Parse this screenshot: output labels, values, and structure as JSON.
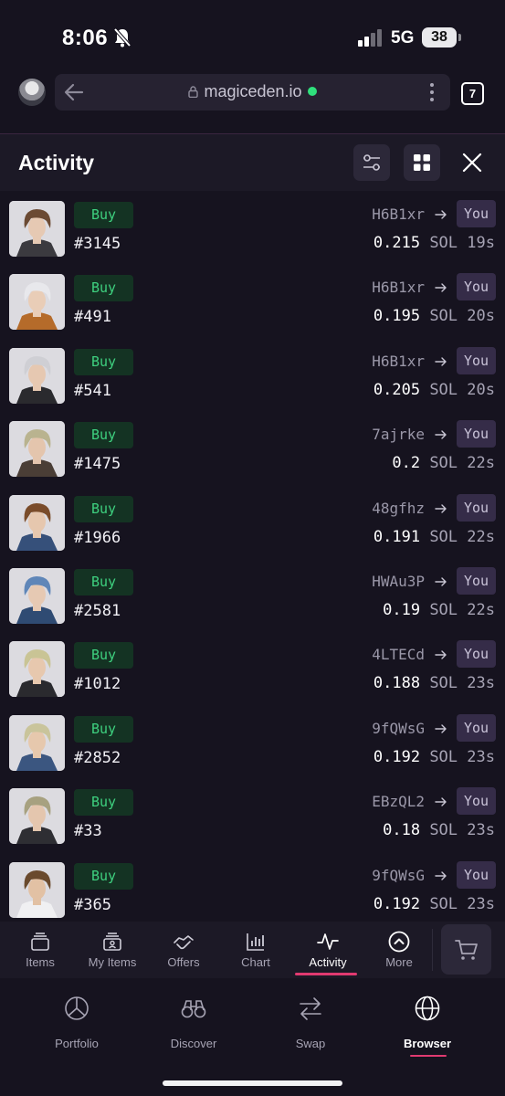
{
  "status_bar": {
    "time": "8:06",
    "network": "5G",
    "battery": "38"
  },
  "browser": {
    "url": "magiceden.io",
    "tab_count": "7"
  },
  "header": {
    "title": "Activity"
  },
  "activity": [
    {
      "type": "Buy",
      "item": "#3145",
      "from": "H6B1xr",
      "to": "You",
      "price": "0.215",
      "currency": "SOL",
      "time": "19s",
      "hair": "#6b4a33",
      "skin": "#e6c9b3",
      "shirt": "#3b3a3f"
    },
    {
      "type": "Buy",
      "item": "#491",
      "from": "H6B1xr",
      "to": "You",
      "price": "0.195",
      "currency": "SOL",
      "time": "20s",
      "hair": "#e8e8ec",
      "skin": "#e9cdb7",
      "shirt": "#b56b2a"
    },
    {
      "type": "Buy",
      "item": "#541",
      "from": "H6B1xr",
      "to": "You",
      "price": "0.205",
      "currency": "SOL",
      "time": "20s",
      "hair": "#cfcfd4",
      "skin": "#e6c8b1",
      "shirt": "#2a2a2e"
    },
    {
      "type": "Buy",
      "item": "#1475",
      "from": "7ajrke",
      "to": "You",
      "price": "0.2",
      "currency": "SOL",
      "time": "22s",
      "hair": "#b9b38f",
      "skin": "#e4c5ad",
      "shirt": "#4a3e36"
    },
    {
      "type": "Buy",
      "item": "#1966",
      "from": "48gfhz",
      "to": "You",
      "price": "0.191",
      "currency": "SOL",
      "time": "22s",
      "hair": "#7a4c2a",
      "skin": "#e6c7ae",
      "shirt": "#36507a"
    },
    {
      "type": "Buy",
      "item": "#2581",
      "from": "HWAu3P",
      "to": "You",
      "price": "0.19",
      "currency": "SOL",
      "time": "22s",
      "hair": "#5f86b8",
      "skin": "#e6c9b3",
      "shirt": "#2f4b73"
    },
    {
      "type": "Buy",
      "item": "#1012",
      "from": "4LTECd",
      "to": "You",
      "price": "0.188",
      "currency": "SOL",
      "time": "23s",
      "hair": "#c9c495",
      "skin": "#e7c8ae",
      "shirt": "#2a2a2e"
    },
    {
      "type": "Buy",
      "item": "#2852",
      "from": "9fQWsG",
      "to": "You",
      "price": "0.192",
      "currency": "SOL",
      "time": "23s",
      "hair": "#c9c49b",
      "skin": "#e6c8ad",
      "shirt": "#3b5680"
    },
    {
      "type": "Buy",
      "item": "#33",
      "from": "EBzQL2",
      "to": "You",
      "price": "0.18",
      "currency": "SOL",
      "time": "23s",
      "hair": "#a7a180",
      "skin": "#e4c6ae",
      "shirt": "#2e2e33"
    },
    {
      "type": "Buy",
      "item": "#365",
      "from": "9fQWsG",
      "to": "You",
      "price": "0.192",
      "currency": "SOL",
      "time": "23s",
      "hair": "#6a4a2d",
      "skin": "#e2c1a4",
      "shirt": "#f0f0f2"
    }
  ],
  "tabs": [
    {
      "label": "Items",
      "icon": "items-icon"
    },
    {
      "label": "My Items",
      "icon": "my-items-icon"
    },
    {
      "label": "Offers",
      "icon": "offers-icon"
    },
    {
      "label": "Chart",
      "icon": "chart-icon"
    },
    {
      "label": "Activity",
      "icon": "activity-icon",
      "active": true
    },
    {
      "label": "More",
      "icon": "more-icon"
    }
  ],
  "nav": [
    {
      "label": "Portfolio",
      "icon": "portfolio-icon"
    },
    {
      "label": "Discover",
      "icon": "discover-icon"
    },
    {
      "label": "Swap",
      "icon": "swap-icon"
    },
    {
      "label": "Browser",
      "icon": "browser-icon",
      "active": true
    }
  ],
  "colors": {
    "accent": "#e13a71",
    "buy_green": "#3ed07f",
    "background": "#16131f"
  }
}
